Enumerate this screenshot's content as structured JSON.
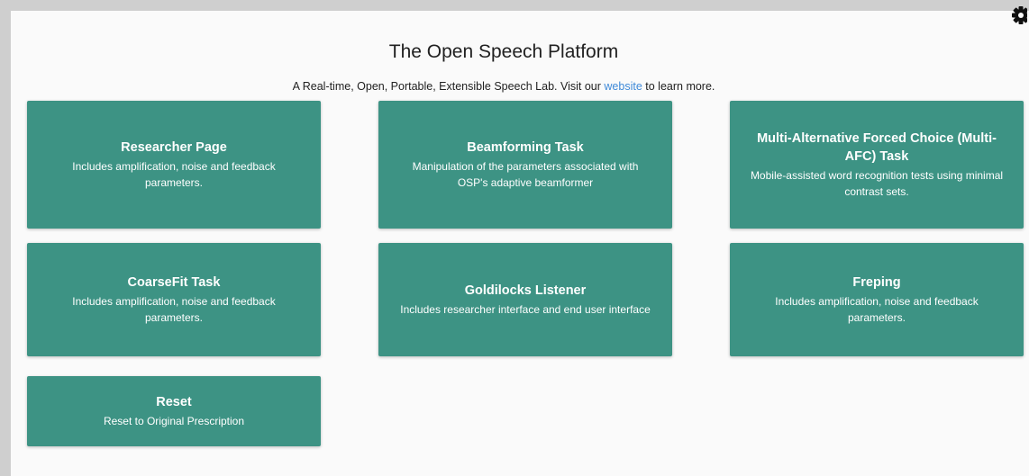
{
  "header": {
    "title": "The Open Speech Platform",
    "subtitle_before": "A Real-time, Open, Portable, Extensible Speech Lab. Visit our",
    "subtitle_link": "website",
    "subtitle_after": "to learn more."
  },
  "settings": {
    "icon": "gear-icon"
  },
  "cards": [
    {
      "title": "Researcher Page",
      "desc": "Includes amplification, noise and feedback parameters."
    },
    {
      "title": "Beamforming Task",
      "desc": "Manipulation of the parameters associated with OSP's adaptive beamformer"
    },
    {
      "title": "Multi-Alternative Forced Choice (Multi-AFC) Task",
      "desc": "Mobile-assisted word recognition tests using minimal contrast sets."
    },
    {
      "title": "CoarseFit Task",
      "desc": "Includes amplification, noise and feedback parameters."
    },
    {
      "title": "Goldilocks Listener",
      "desc": "Includes researcher interface and end user interface"
    },
    {
      "title": "Freping",
      "desc": "Includes amplification, noise and feedback parameters."
    },
    {
      "title": "Reset",
      "desc": "Reset to Original Prescription"
    }
  ],
  "colors": {
    "card_background": "#3d9384",
    "link": "#3f8ad8"
  }
}
